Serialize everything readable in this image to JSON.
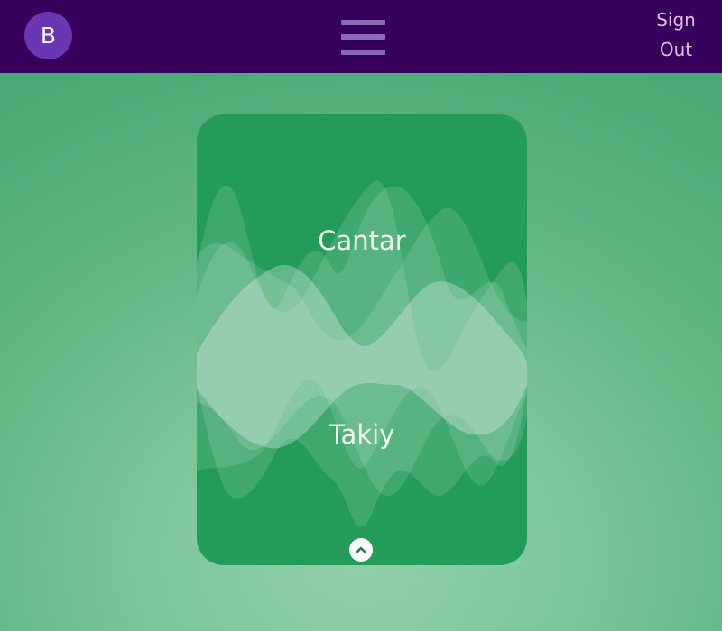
{
  "header": {
    "avatar_letter": "B",
    "menu_icon": "hamburger-menu-icon",
    "sign_out_label": [
      "Sign",
      "Out"
    ]
  },
  "card": {
    "front_word": "Cantar",
    "back_word": "Takiy",
    "flip_icon": "chevron-up-icon"
  },
  "colors": {
    "header_bg": "#37005a",
    "avatar_bg": "#6a36b3",
    "menu_icon": "#8a6bb3",
    "sign_out_text": "#e8b9e8",
    "card_bg": "#239c59",
    "page_bg": "#6cbc8c"
  }
}
